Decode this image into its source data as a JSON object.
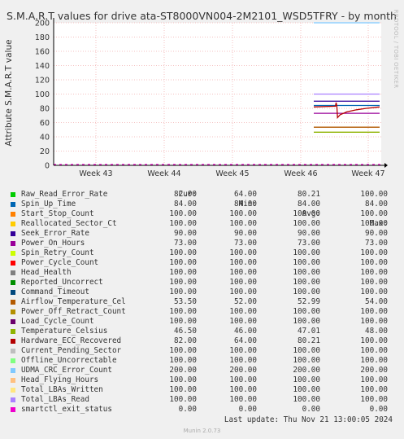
{
  "chart_data": {
    "type": "line",
    "title": "S.M.A.R.T values for drive ata-ST8000VN004-2M2101_WSD5TFRY - by month",
    "ylabel": "Attribute S.M.A.R.T value",
    "side_text": "RRDTOOL / TOBI OETIKER",
    "ylim": [
      0,
      200
    ],
    "y_ticks": [
      0,
      20,
      40,
      60,
      80,
      100,
      120,
      140,
      160,
      180,
      200
    ],
    "x_ticks": [
      "Week 43",
      "Week 44",
      "Week 45",
      "Week 46",
      "Week 47"
    ],
    "grid": true,
    "columns": [
      "Cur:",
      "Min:",
      "Avg:",
      "Max:"
    ],
    "series": [
      {
        "name": "Raw_Read_Error_Rate",
        "color": "#00cc00",
        "cur": "82.00",
        "min": "64.00",
        "avg": "80.21",
        "max": "100.00"
      },
      {
        "name": "Spin_Up_Time",
        "color": "#0066b3",
        "cur": "84.00",
        "min": "84.00",
        "avg": "84.00",
        "max": "84.00"
      },
      {
        "name": "Start_Stop_Count",
        "color": "#ff8000",
        "cur": "100.00",
        "min": "100.00",
        "avg": "100.00",
        "max": "100.00"
      },
      {
        "name": "Reallocated_Sector_Ct",
        "color": "#ffcc00",
        "cur": "100.00",
        "min": "100.00",
        "avg": "100.00",
        "max": "100.00"
      },
      {
        "name": "Seek_Error_Rate",
        "color": "#330099",
        "cur": "90.00",
        "min": "90.00",
        "avg": "90.00",
        "max": "90.00"
      },
      {
        "name": "Power_On_Hours",
        "color": "#990099",
        "cur": "73.00",
        "min": "73.00",
        "avg": "73.00",
        "max": "73.00"
      },
      {
        "name": "Spin_Retry_Count",
        "color": "#ccff00",
        "cur": "100.00",
        "min": "100.00",
        "avg": "100.00",
        "max": "100.00"
      },
      {
        "name": "Power_Cycle_Count",
        "color": "#ff0000",
        "cur": "100.00",
        "min": "100.00",
        "avg": "100.00",
        "max": "100.00"
      },
      {
        "name": "Head_Health",
        "color": "#808080",
        "cur": "100.00",
        "min": "100.00",
        "avg": "100.00",
        "max": "100.00"
      },
      {
        "name": "Reported_Uncorrect",
        "color": "#008f00",
        "cur": "100.00",
        "min": "100.00",
        "avg": "100.00",
        "max": "100.00"
      },
      {
        "name": "Command_Timeout",
        "color": "#00487d",
        "cur": "100.00",
        "min": "100.00",
        "avg": "100.00",
        "max": "100.00"
      },
      {
        "name": "Airflow_Temperature_Cel",
        "color": "#b35a00",
        "cur": "53.50",
        "min": "52.00",
        "avg": "52.99",
        "max": "54.00"
      },
      {
        "name": "Power_Off_Retract_Count",
        "color": "#b38f00",
        "cur": "100.00",
        "min": "100.00",
        "avg": "100.00",
        "max": "100.00"
      },
      {
        "name": "Load_Cycle_Count",
        "color": "#6b006b",
        "cur": "100.00",
        "min": "100.00",
        "avg": "100.00",
        "max": "100.00"
      },
      {
        "name": "Temperature_Celsius",
        "color": "#8fb300",
        "cur": "46.50",
        "min": "46.00",
        "avg": "47.01",
        "max": "48.00"
      },
      {
        "name": "Hardware_ECC_Recovered",
        "color": "#b30000",
        "cur": "82.00",
        "min": "64.00",
        "avg": "80.21",
        "max": "100.00"
      },
      {
        "name": "Current_Pending_Sector",
        "color": "#bebebe",
        "cur": "100.00",
        "min": "100.00",
        "avg": "100.00",
        "max": "100.00"
      },
      {
        "name": "Offline_Uncorrectable",
        "color": "#80ff80",
        "cur": "100.00",
        "min": "100.00",
        "avg": "100.00",
        "max": "100.00"
      },
      {
        "name": "UDMA_CRC_Error_Count",
        "color": "#80c9ff",
        "cur": "200.00",
        "min": "200.00",
        "avg": "200.00",
        "max": "200.00"
      },
      {
        "name": "Head_Flying_Hours",
        "color": "#ffc080",
        "cur": "100.00",
        "min": "100.00",
        "avg": "100.00",
        "max": "100.00"
      },
      {
        "name": "Total_LBAs_Written",
        "color": "#ffe680",
        "cur": "100.00",
        "min": "100.00",
        "avg": "100.00",
        "max": "100.00"
      },
      {
        "name": "Total_LBAs_Read",
        "color": "#aa80ff",
        "cur": "100.00",
        "min": "100.00",
        "avg": "100.00",
        "max": "100.00"
      },
      {
        "name": "smartctl_exit_status",
        "color": "#ee00cc",
        "cur": "0.00",
        "min": "0.00",
        "avg": "0.00",
        "max": "0.00"
      }
    ],
    "ecc_trace": [
      {
        "t": 0.0,
        "v": 82
      },
      {
        "t": 0.33,
        "v": 83
      },
      {
        "t": 0.34,
        "v": 88
      },
      {
        "t": 0.35,
        "v": 83
      },
      {
        "t": 0.36,
        "v": 67
      },
      {
        "t": 0.4,
        "v": 71
      },
      {
        "t": 0.5,
        "v": 75
      },
      {
        "t": 0.65,
        "v": 78
      },
      {
        "t": 0.8,
        "v": 80
      },
      {
        "t": 1.0,
        "v": 82
      }
    ]
  },
  "footer": {
    "last_update": "Last update: Thu Nov 21 13:00:05 2024",
    "version": "Munin 2.0.73"
  }
}
